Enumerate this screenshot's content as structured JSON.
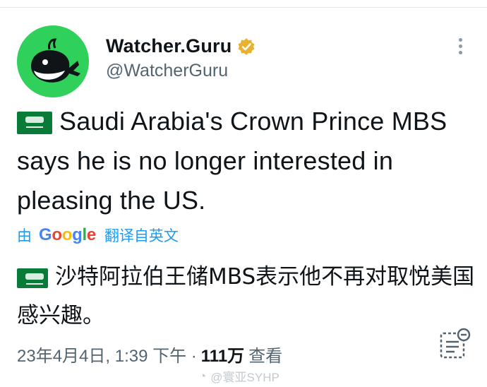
{
  "account": {
    "display_name": "Watcher.Guru",
    "handle": "@WatcherGuru",
    "avatar_color": "#2fd15a",
    "verified_badge_color": "#e8b12e"
  },
  "tweet": {
    "flag_icon": "saudi-arabia-flag-icon",
    "text_en": "Saudi Arabia's Crown Prince MBS says he is no longer interested in pleasing the US.",
    "translate": {
      "by": "由",
      "provider": "Google",
      "label": "翻译自英文"
    },
    "text_zh": "沙特阿拉伯王储MBS表示他不再对取悦美国感兴趣。"
  },
  "meta": {
    "timestamp": "23年4月4日, 1:39 下午 ·",
    "view_count": "111万",
    "views_label": "查看"
  },
  "watermark": "@寰亚SYHP",
  "colors": {
    "link": "#1d9bf0",
    "secondary_text": "#536471",
    "flag_green": "#0a7a39"
  }
}
